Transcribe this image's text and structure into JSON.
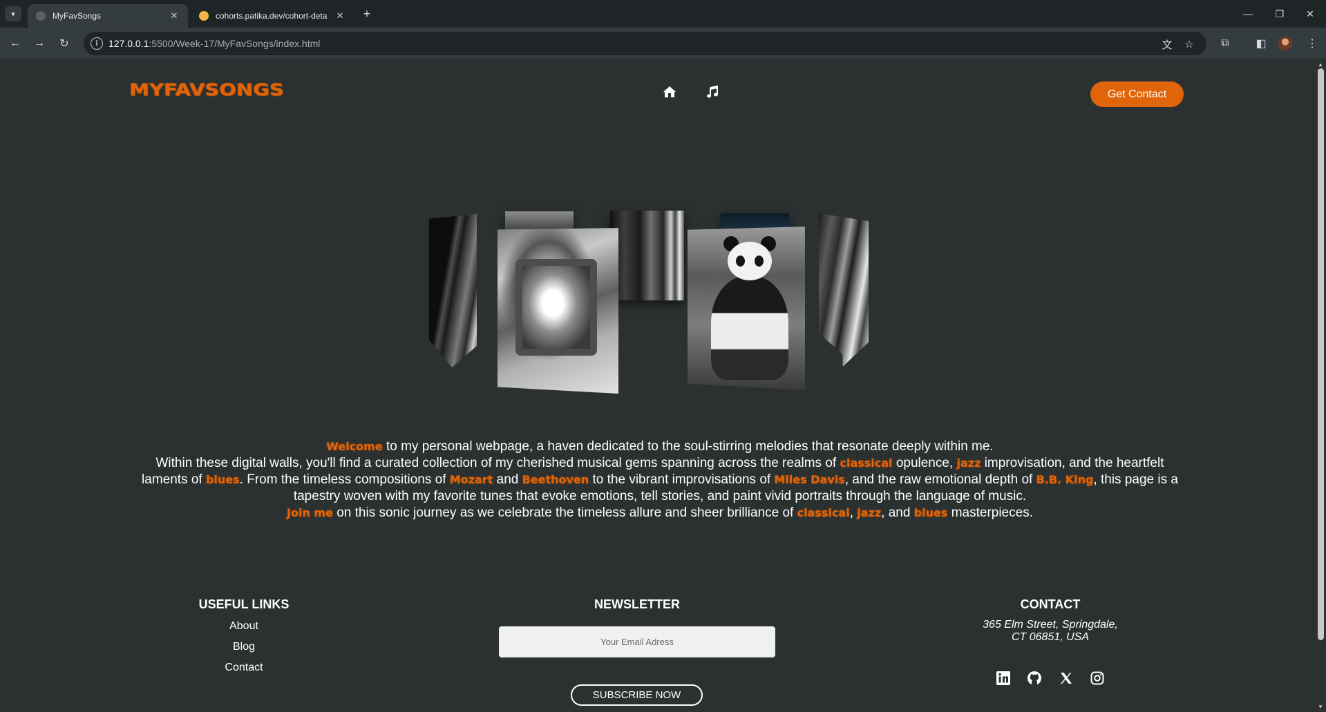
{
  "browser": {
    "tabs": [
      {
        "label": "MyFavSongs",
        "active": true,
        "favicon_color": "#5a5f62"
      },
      {
        "label": "cohorts.patika.dev/cohort-deta",
        "active": false,
        "favicon_color": "#f5b544"
      }
    ],
    "url_host": "127.0.0.1",
    "url_path": ":5500/Week-17/MyFavSongs/index.html",
    "icons": [
      "tab-search-icon",
      "back-icon",
      "forward-icon",
      "reload-icon",
      "site-info-icon",
      "translate-icon",
      "bookmark-star-icon",
      "extensions-icon",
      "side-panel-icon",
      "profile-avatar",
      "menu-icon",
      "minimize-icon",
      "restore-icon",
      "close-icon"
    ]
  },
  "header": {
    "logo": "MYFAVSONGS",
    "nav_icons": [
      "home-icon",
      "music-icon"
    ],
    "contact_button": "Get Contact"
  },
  "intro": {
    "p1": {
      "hl": "Welcome",
      "text": "to my personal webpage, a haven dedicated to the soul-stirring melodies that resonate deeply within me."
    },
    "p2_a": "Within these digital walls, you'll find a curated collection of my cherished musical gems spanning across the realms of",
    "p2_classical": "classical",
    "p2_b": "opulence,",
    "p2_jazz": "jazz",
    "p2_c": "improvisation, and the heartfelt laments of",
    "p2_blues": "blues",
    "p2_d": ". From the timeless compositions of",
    "p2_mozart": "Mozart",
    "p2_and": "and",
    "p2_beethoven": "Beethoven",
    "p2_e": "to the vibrant improvisations of",
    "p2_miles": "Miles Davis",
    "p2_f": ", and the raw emotional depth of",
    "p2_bbking": "B.B. King",
    "p2_g": ", this page is a tapestry woven with my favorite tunes that evoke emotions, tell stories, and paint vivid portraits through the language of music.",
    "p3_join": "Join me",
    "p3_a": "on this sonic journey as we celebrate the timeless allure and sheer brilliance of",
    "p3_classical": "classical",
    "p3_comma": ",",
    "p3_jazz": "jazz",
    "p3_and": ", and",
    "p3_blues": "blues",
    "p3_end": "masterpieces."
  },
  "footer": {
    "useful_links": {
      "title": "USEFUL LINKS",
      "items": [
        "About",
        "Blog",
        "Contact"
      ]
    },
    "newsletter": {
      "title": "NEWSLETTER",
      "placeholder": "Your Email Adress",
      "button": "SUBSCRIBE NOW"
    },
    "contact": {
      "title": "CONTACT",
      "address_line1": "365 Elm Street, Springdale,",
      "address_line2": "CT 06851, USA",
      "social_icons": [
        "linkedin-icon",
        "github-icon",
        "x-twitter-icon",
        "instagram-icon"
      ]
    }
  },
  "colors": {
    "accent": "#e0650a",
    "background": "#2b3131",
    "text": "#ffffff"
  }
}
